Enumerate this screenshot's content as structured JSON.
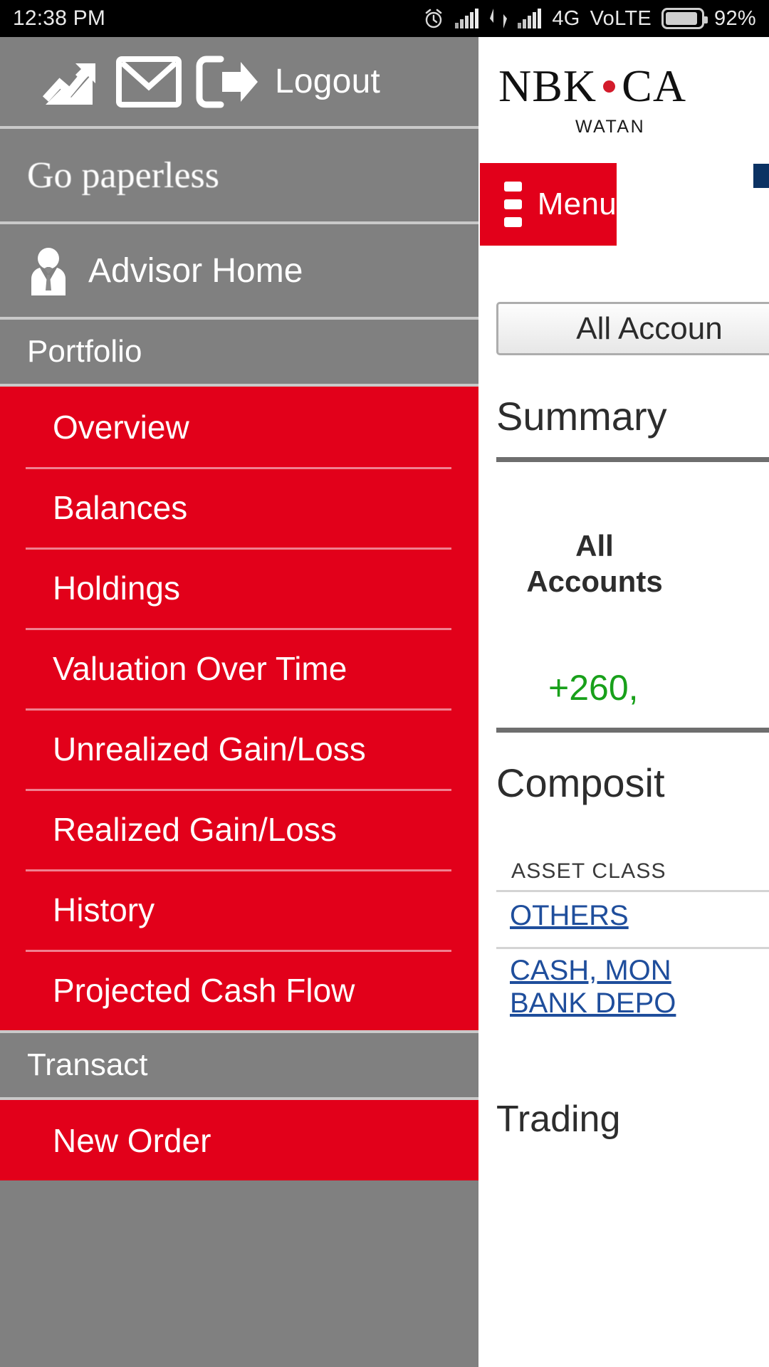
{
  "statusbar": {
    "time": "12:38 PM",
    "network": "4G",
    "volte": "VoLTE",
    "battery": "92%",
    "icons": [
      "alarm-clock-icon",
      "signal-bars-icon",
      "data-transfer-icon",
      "signal-bars-icon",
      "battery-icon"
    ]
  },
  "brand": {
    "logo_main_left": "NBK",
    "logo_main_right": "CA",
    "logo_sub": "WATAN",
    "accent_red": "#e2001a",
    "dot_color": "#d31b2b"
  },
  "page": {
    "menu_button": "Menu",
    "account_select_value": "All Accoun",
    "summary_heading": "Summary",
    "all_accounts_label": "All Accounts",
    "gain_value": "+260,",
    "gain_color": "#18a01a",
    "composition_heading": "Composit",
    "table_header": "ASSET CLASS",
    "rows": [
      {
        "label": "OTHERS"
      },
      {
        "label": "CASH, MON",
        "label2": "BANK DEPO"
      }
    ],
    "trading_heading": "Trading"
  },
  "drawer": {
    "top_bar": {
      "chart_icon": "trending-up-icon",
      "mail_icon": "envelope-icon",
      "logout_icon": "logout-arrow-icon",
      "logout_label": "Logout"
    },
    "paperless_label": "Go paperless",
    "advisor": {
      "icon": "advisor-avatar-icon",
      "label": "Advisor Home"
    },
    "sections": [
      {
        "title": "Portfolio",
        "items": [
          "Overview",
          "Balances",
          "Holdings",
          "Valuation Over Time",
          "Unrealized Gain/Loss",
          "Realized Gain/Loss",
          "History",
          "Projected Cash Flow"
        ]
      },
      {
        "title": "Transact",
        "items": [
          "New Order"
        ]
      }
    ]
  }
}
